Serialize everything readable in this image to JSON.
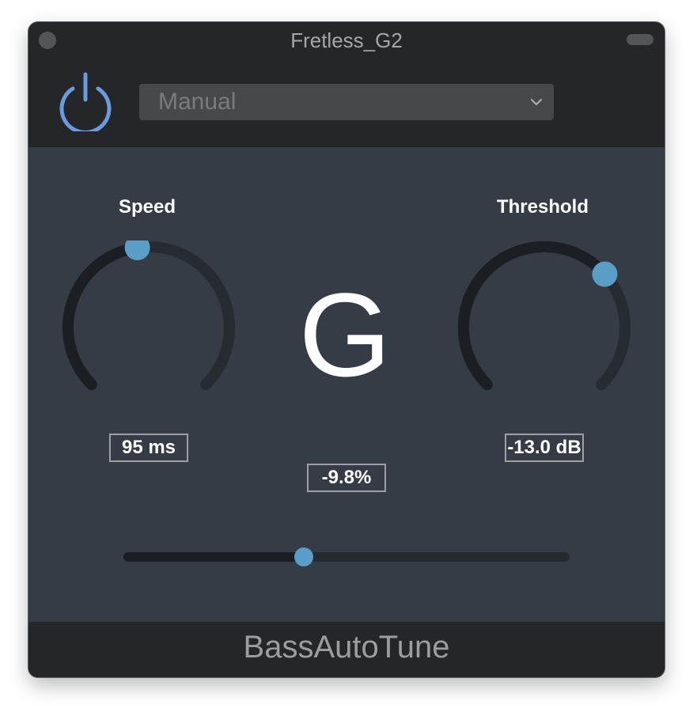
{
  "window": {
    "title": "Fretless_G2"
  },
  "toolbar": {
    "power_state": "on",
    "preset": {
      "selected": "Manual"
    }
  },
  "knobs": {
    "speed": {
      "label": "Speed",
      "value_text": "95 ms",
      "level": 0.47
    },
    "threshold": {
      "label": "Threshold",
      "value_text": "-13.0 dB",
      "level": 0.68
    }
  },
  "tuner": {
    "note": "G",
    "deviation": "-9.8%"
  },
  "slider": {
    "level": 0.405
  },
  "footer": {
    "plugin_name": "BassAutoTune"
  },
  "colors": {
    "accent": "#5a9dc7",
    "power": "#6a9be0",
    "knob_track": "#262b31",
    "knob_fill": "#1b1e22",
    "panel": "#353c45"
  },
  "icons": {
    "power": "power-icon",
    "dropdown": "chevron-down-icon",
    "window_control": "window-dot"
  }
}
